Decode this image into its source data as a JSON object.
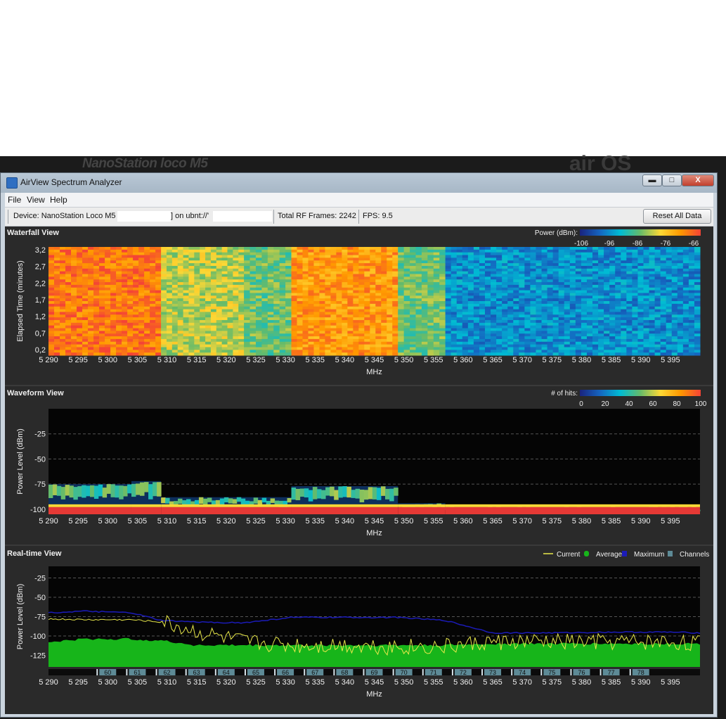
{
  "background": {
    "brand_left": "NanoStation loco M5",
    "brand_right": "air OS"
  },
  "window": {
    "title": "AirView Spectrum Analyzer",
    "controls": {
      "minimize": "▬",
      "maximize": "□",
      "close": "X"
    },
    "menu": [
      "File",
      "View",
      "Help"
    ]
  },
  "info": {
    "device_label": "Device: NanoStation Loco M5 '",
    "device_tail": "] on ubnt://'",
    "frames": "Total RF Frames: 2242",
    "fps": "FPS: 9.5",
    "reset_label": "Reset All Data"
  },
  "colors": {
    "accent_ramp": [
      "#1a237e",
      "#1565c0",
      "#00bcd4",
      "#66bb6a",
      "#fdd835",
      "#ff9800",
      "#f44336"
    ],
    "current": "#e8e84a",
    "average": "#17b51a",
    "maximum": "#1b1bb8",
    "channels": "#5d8a96"
  },
  "x_axis": {
    "label": "MHz",
    "ticks": [
      "5 290",
      "5 295",
      "5 300",
      "5 305",
      "5 310",
      "5 315",
      "5 320",
      "5 325",
      "5 330",
      "5 335",
      "5 340",
      "5 345",
      "5 350",
      "5 355",
      "5 360",
      "5 365",
      "5 370",
      "5 375",
      "5 380",
      "5 385",
      "5 390",
      "5 395"
    ]
  },
  "waterfall": {
    "title": "Waterfall View",
    "ylabel": "Elapsed Time (minutes)",
    "yticks": [
      "3,2",
      "2,7",
      "2,2",
      "1,7",
      "1,2",
      "0,7",
      "0,2"
    ],
    "legend_title": "Power (dBm):",
    "legend_ticks": [
      "-106",
      "-96",
      "-86",
      "-76",
      "-66"
    ]
  },
  "waveform": {
    "title": "Waveform View",
    "ylabel": "Power Level (dBm)",
    "yticks": [
      "-25",
      "-50",
      "-75",
      "-100"
    ],
    "legend_title": "# of hits:",
    "legend_ticks": [
      "0",
      "20",
      "40",
      "60",
      "80",
      "100"
    ]
  },
  "realtime": {
    "title": "Real-time View",
    "ylabel": "Power Level (dBm)",
    "yticks": [
      "-25",
      "-50",
      "-75",
      "-100",
      "-125"
    ],
    "legend": [
      "Current",
      "Average",
      "Maximum",
      "Channels"
    ],
    "channels": [
      "60",
      "61",
      "62",
      "63",
      "64",
      "65",
      "66",
      "67",
      "68",
      "69",
      "70",
      "71",
      "72",
      "73",
      "74",
      "75",
      "76",
      "77",
      "78"
    ]
  },
  "chart_data": [
    {
      "type": "heatmap",
      "title": "Waterfall View",
      "xlabel": "MHz",
      "ylabel": "Elapsed Time (minutes)",
      "xlim": [
        5290,
        5400
      ],
      "ylim": [
        0,
        3.3
      ],
      "bands": [
        {
          "x": [
            5290,
            5309
          ],
          "level_dbm": -70
        },
        {
          "x": [
            5309,
            5323
          ],
          "level_dbm": -82
        },
        {
          "x": [
            5323,
            5331
          ],
          "level_dbm": -86
        },
        {
          "x": [
            5331,
            5349
          ],
          "level_dbm": -73
        },
        {
          "x": [
            5349,
            5357
          ],
          "level_dbm": -86
        },
        {
          "x": [
            5357,
            5400
          ],
          "level_dbm": -96
        }
      ]
    },
    {
      "type": "heatmap",
      "title": "Waveform View",
      "xlabel": "MHz",
      "ylabel": "Power Level (dBm)",
      "xlim": [
        5290,
        5400
      ],
      "ylim": [
        -105,
        0
      ],
      "bands": [
        {
          "x": [
            5290,
            5304
          ],
          "low": -100,
          "high": -75
        },
        {
          "x": [
            5304,
            5309
          ],
          "low": -100,
          "high": -72
        },
        {
          "x": [
            5309,
            5331
          ],
          "low": -100,
          "high": -88
        },
        {
          "x": [
            5331,
            5349
          ],
          "low": -100,
          "high": -77
        },
        {
          "x": [
            5349,
            5357
          ],
          "low": -100,
          "high": -94
        },
        {
          "x": [
            5357,
            5400
          ],
          "low": -100,
          "high": -97
        }
      ]
    },
    {
      "type": "line",
      "title": "Real-time View",
      "xlabel": "MHz",
      "ylabel": "Power Level (dBm)",
      "xlim": [
        5290,
        5400
      ],
      "ylim": [
        -140,
        -10
      ],
      "x": [
        5290,
        5296,
        5304,
        5309,
        5315,
        5323,
        5331,
        5340,
        5349,
        5357,
        5365,
        5375,
        5385,
        5395,
        5400
      ],
      "series": [
        {
          "name": "Current",
          "values": [
            -78,
            -79,
            -79,
            -82,
            -95,
            -108,
            -112,
            -112,
            -114,
            -114,
            -108,
            -108,
            -108,
            -108,
            -110
          ]
        },
        {
          "name": "Average",
          "values": [
            -108,
            -104,
            -104,
            -106,
            -112,
            -112,
            -112,
            -112,
            -112,
            -112,
            -110,
            -110,
            -110,
            -110,
            -110
          ]
        },
        {
          "name": "Maximum",
          "values": [
            -70,
            -68,
            -70,
            -80,
            -82,
            -83,
            -76,
            -76,
            -76,
            -80,
            -96,
            -96,
            -95,
            -95,
            -96
          ]
        }
      ]
    }
  ]
}
